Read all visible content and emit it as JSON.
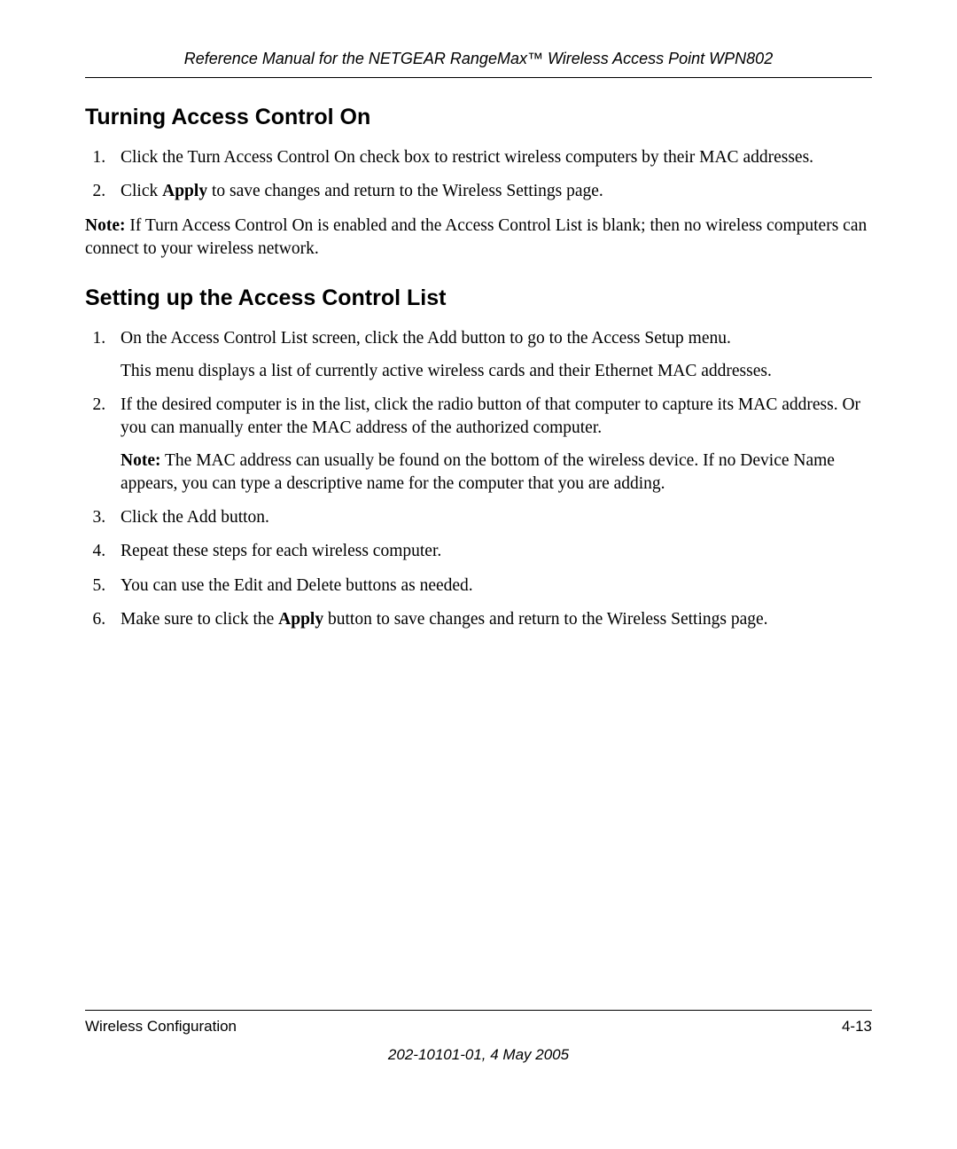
{
  "header": {
    "title": "Reference Manual for the NETGEAR RangeMax™ Wireless Access Point WPN802"
  },
  "section1": {
    "heading": "Turning Access Control On",
    "items": [
      "Click the Turn Access Control On check box to restrict wireless computers by their MAC addresses.",
      "Click <b>Apply</b> to save changes and return to the Wireless Settings page."
    ],
    "note": "<b>Note:</b> If Turn Access Control On is enabled and the Access Control List is blank; then no wireless computers can connect to your wireless network."
  },
  "section2": {
    "heading": "Setting up the Access Control List",
    "items": [
      "On the Access Control List screen, click the Add button to go to the Access Setup menu.<span class='sub'>This menu displays a list of currently active wireless cards and their Ethernet MAC addresses.</span>",
      "If the desired computer is in the list, click the radio button of that computer to capture its MAC address. Or you can manually enter the MAC address of the authorized computer.<span class='sub'><b>Note:</b> The MAC address can usually be found on the bottom of the wireless device. If no Device Name appears, you can type a descriptive name for the computer that you are adding.</span>",
      "Click the Add button.",
      "Repeat these steps for each wireless computer.",
      "You can use the Edit and Delete buttons as needed.",
      "Make sure to click the <b>Apply</b> button to save changes and return to the Wireless Settings page."
    ]
  },
  "footer": {
    "left": "Wireless Configuration",
    "right": "4-13",
    "meta": "202-10101-01, 4 May 2005"
  }
}
